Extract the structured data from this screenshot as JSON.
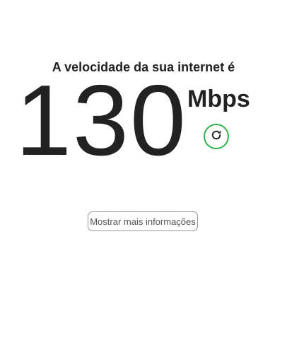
{
  "result": {
    "headline": "A velocidade da sua internet é",
    "speed_value": "130",
    "speed_unit": "Mbps"
  },
  "refresh": {
    "icon": "refresh-icon",
    "accent_color": "#2db34a"
  },
  "more_info": {
    "label": "Mostrar mais informações"
  }
}
